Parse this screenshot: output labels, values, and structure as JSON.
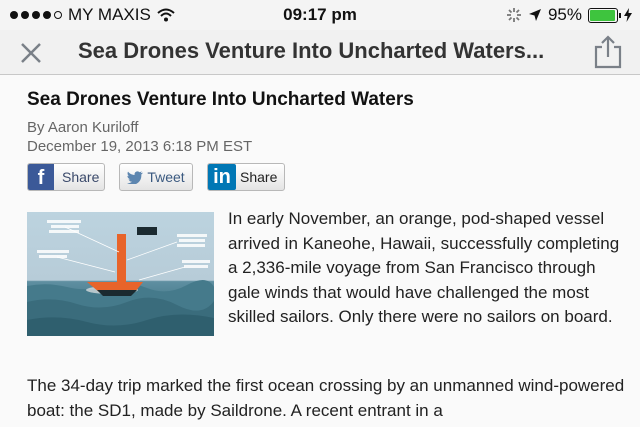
{
  "status_bar": {
    "carrier": "MY MAXIS",
    "time": "09:17 pm",
    "battery": "95%",
    "battery_level": 0.95,
    "icons": [
      "signal-dots-icon",
      "wifi-icon",
      "activity-icon",
      "location-arrow-icon",
      "battery-icon",
      "charging-icon"
    ]
  },
  "nav": {
    "title": "Sea Drones Venture Into Uncharted Waters...",
    "icons": [
      "close-icon",
      "share-icon"
    ]
  },
  "article": {
    "headline": "Sea Drones Venture Into Uncharted Waters",
    "byline": "By Aaron Kuriloff",
    "date": "December 19, 2013 6:18 PM EST",
    "lead": "In early November, an orange, pod-shaped vessel arrived in Kaneohe, Hawaii, successfully completing a 2,336-mile voyage from San Francisco through gale winds that would have challenged the most skilled sailors. Only there were no sailors on board.",
    "paragraph2": "The 34-day trip marked the first ocean crossing by an unmanned wind-powered boat: the SD1, made by Saildrone. A recent entrant in a"
  },
  "social": {
    "facebook": {
      "icon_text": "f",
      "label": "Share"
    },
    "twitter": {
      "label": "Tweet"
    },
    "linkedin": {
      "icon_text": "in",
      "label": "Share"
    }
  },
  "colors": {
    "facebook": "#3b5998",
    "linkedin": "#0077b5",
    "battery": "#3ec43e",
    "drone": "#e8642a"
  }
}
